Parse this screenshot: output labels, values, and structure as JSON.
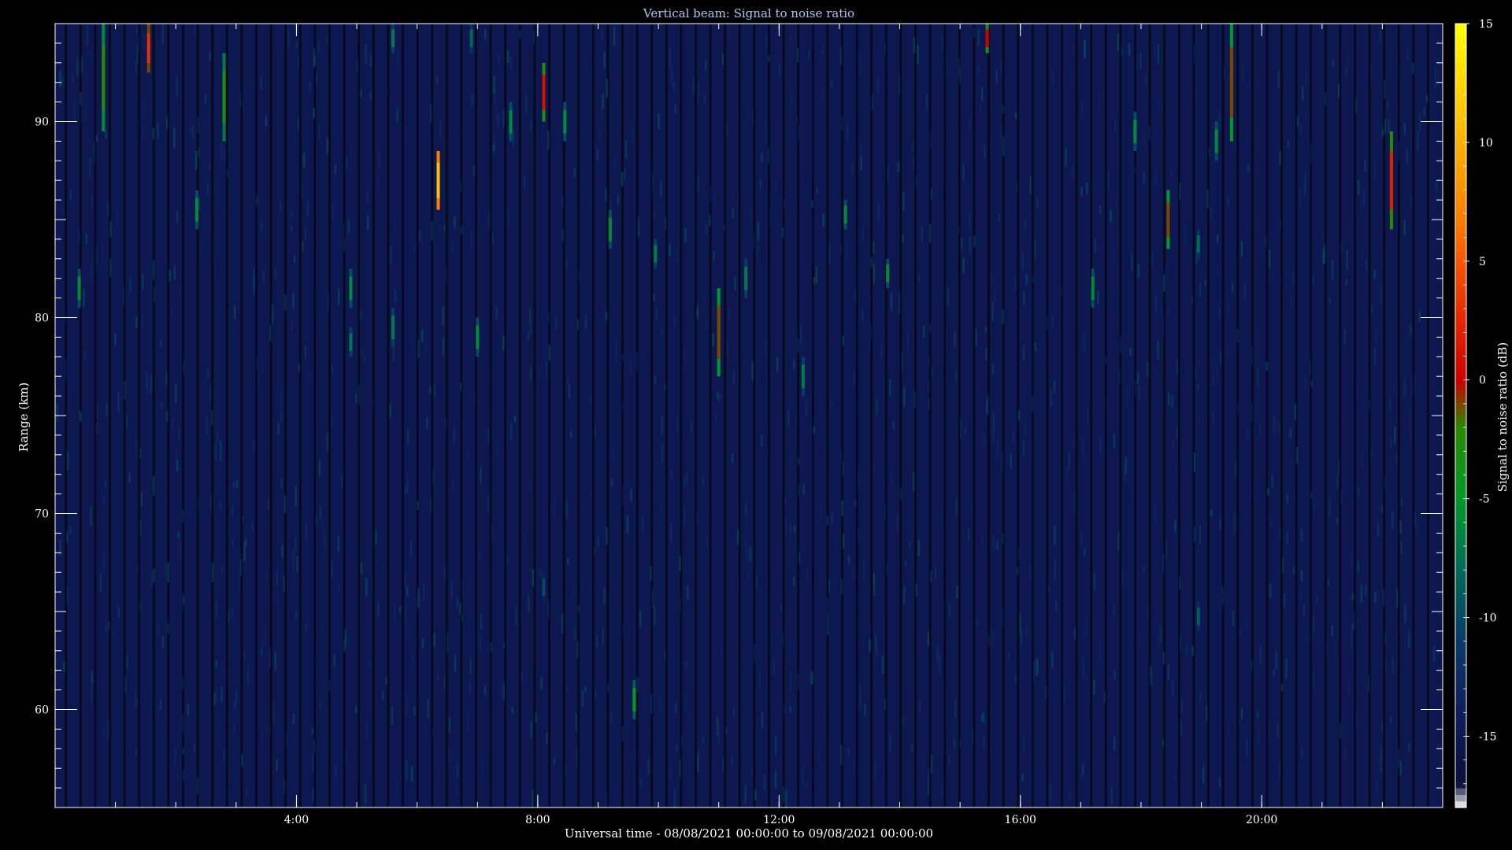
{
  "chart_data": {
    "type": "heatmap",
    "title": "Vertical beam: Signal to noise ratio",
    "xlabel": "Universal time - 08/08/2021 00:00:00 to 09/08/2021 00:00:00",
    "ylabel": "Range (km)",
    "colorbar_label": "Signal to noise ratio (dB)",
    "x_unit": "hours UT",
    "xlim": [
      0,
      23
    ],
    "ylim": [
      55,
      95
    ],
    "x_ticks": [
      {
        "value": 4,
        "label": "4:00"
      },
      {
        "value": 8,
        "label": "8:00"
      },
      {
        "value": 12,
        "label": "12:00"
      },
      {
        "value": 16,
        "label": "16:00"
      },
      {
        "value": 20,
        "label": "20:00"
      }
    ],
    "y_ticks": [
      {
        "value": 60,
        "label": "60"
      },
      {
        "value": 70,
        "label": "70"
      },
      {
        "value": 80,
        "label": "80"
      },
      {
        "value": 90,
        "label": "90"
      }
    ],
    "colorbar": {
      "range": [
        -18,
        15
      ],
      "ticks": [
        {
          "value": 15,
          "label": "15"
        },
        {
          "value": 10,
          "label": "10"
        },
        {
          "value": 5,
          "label": "5"
        },
        {
          "value": 0,
          "label": "0"
        },
        {
          "value": -5,
          "label": "-5"
        },
        {
          "value": -10,
          "label": "-10"
        },
        {
          "value": -15,
          "label": "-15"
        }
      ],
      "colormap_stops": [
        {
          "value": -18,
          "color": "#ffffff"
        },
        {
          "value": -17,
          "color": "#0a0f3a"
        },
        {
          "value": -14,
          "color": "#101e5a"
        },
        {
          "value": -11,
          "color": "#0b3a66"
        },
        {
          "value": -8,
          "color": "#006a5a"
        },
        {
          "value": -5,
          "color": "#009a2a"
        },
        {
          "value": -2,
          "color": "#2a8a00"
        },
        {
          "value": 0,
          "color": "#cc0000"
        },
        {
          "value": 3,
          "color": "#e83000"
        },
        {
          "value": 7,
          "color": "#ff8000"
        },
        {
          "value": 11,
          "color": "#ffc000"
        },
        {
          "value": 15,
          "color": "#ffff00"
        }
      ]
    },
    "background_snr_db": -14,
    "echo_segments": [
      {
        "t": 0.4,
        "r0": 80.5,
        "r1": 82.5,
        "snr": -6
      },
      {
        "t": 0.8,
        "r0": 89.5,
        "r1": 95.0,
        "snr": -2
      },
      {
        "t": 1.55,
        "r0": 92.5,
        "r1": 95.0,
        "snr": 3
      },
      {
        "t": 2.35,
        "r0": 84.5,
        "r1": 86.5,
        "snr": -6
      },
      {
        "t": 2.8,
        "r0": 89.0,
        "r1": 93.5,
        "snr": -3
      },
      {
        "t": 4.9,
        "r0": 80.5,
        "r1": 82.5,
        "snr": -6
      },
      {
        "t": 4.9,
        "r0": 78.0,
        "r1": 79.5,
        "snr": -7
      },
      {
        "t": 5.6,
        "r0": 78.5,
        "r1": 80.5,
        "snr": -7
      },
      {
        "t": 5.6,
        "r0": 93.5,
        "r1": 95.0,
        "snr": -7
      },
      {
        "t": 6.35,
        "r0": 85.5,
        "r1": 88.5,
        "snr": 11
      },
      {
        "t": 6.9,
        "r0": 93.5,
        "r1": 95.0,
        "snr": -8
      },
      {
        "t": 7.0,
        "r0": 78.0,
        "r1": 80.0,
        "snr": -6
      },
      {
        "t": 7.55,
        "r0": 89.0,
        "r1": 91.0,
        "snr": -6
      },
      {
        "t": 8.1,
        "r0": 90.0,
        "r1": 93.0,
        "snr": 1
      },
      {
        "t": 8.1,
        "r0": 65.5,
        "r1": 67.0,
        "snr": -10
      },
      {
        "t": 8.45,
        "r0": 89.0,
        "r1": 91.0,
        "snr": -6
      },
      {
        "t": 9.2,
        "r0": 83.5,
        "r1": 85.5,
        "snr": -6
      },
      {
        "t": 9.6,
        "r0": 59.5,
        "r1": 61.5,
        "snr": -5
      },
      {
        "t": 9.95,
        "r0": 82.5,
        "r1": 84.0,
        "snr": -7
      },
      {
        "t": 11.0,
        "r0": 77.0,
        "r1": 81.5,
        "snr": -1
      },
      {
        "t": 11.45,
        "r0": 81.0,
        "r1": 83.0,
        "snr": -7
      },
      {
        "t": 12.4,
        "r0": 76.0,
        "r1": 78.0,
        "snr": -7
      },
      {
        "t": 13.1,
        "r0": 84.5,
        "r1": 86.0,
        "snr": -6
      },
      {
        "t": 13.8,
        "r0": 81.5,
        "r1": 83.0,
        "snr": -6
      },
      {
        "t": 15.45,
        "r0": 93.5,
        "r1": 95.0,
        "snr": 0
      },
      {
        "t": 17.2,
        "r0": 80.5,
        "r1": 82.5,
        "snr": -6
      },
      {
        "t": 17.9,
        "r0": 88.5,
        "r1": 90.5,
        "snr": -6
      },
      {
        "t": 18.45,
        "r0": 83.5,
        "r1": 86.5,
        "snr": -1
      },
      {
        "t": 18.95,
        "r0": 83.0,
        "r1": 84.5,
        "snr": -8
      },
      {
        "t": 18.95,
        "r0": 64.0,
        "r1": 65.5,
        "snr": -9
      },
      {
        "t": 19.25,
        "r0": 88.0,
        "r1": 90.0,
        "snr": -6
      },
      {
        "t": 19.5,
        "r0": 89.0,
        "r1": 95.0,
        "snr": -1
      },
      {
        "t": 22.15,
        "r0": 84.5,
        "r1": 89.5,
        "snr": 2
      }
    ]
  }
}
